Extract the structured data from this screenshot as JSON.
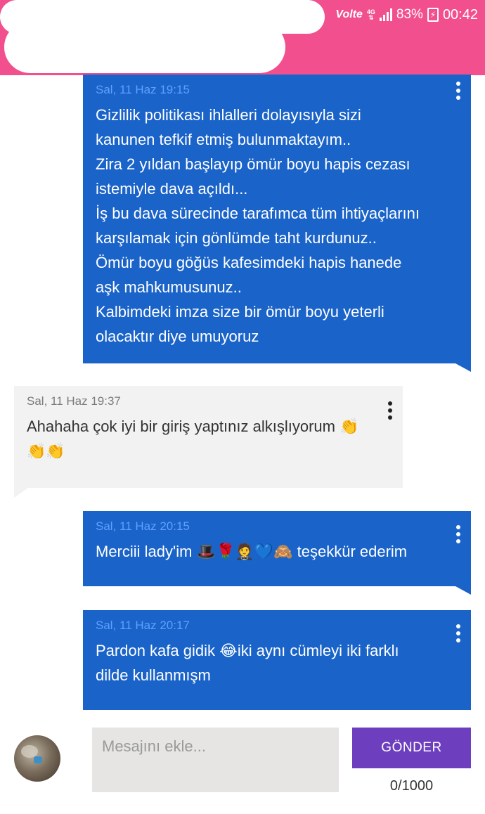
{
  "status_bar": {
    "volte": "Volte",
    "network": "4G",
    "battery_percent": "83%",
    "battery_glyph": "⚡",
    "time": "00:42"
  },
  "messages": [
    {
      "side": "right",
      "timestamp": "Sal, 11 Haz 19:15",
      "text": "Gizlilik politikası ihlalleri dolayısıyla sizi\nkanunen tefkif etmiş bulunmaktayım..\nZira 2 yıldan başlayıp ömür boyu hapis cezası\nistemiyle dava açıldı...\nİş bu dava sürecinde tarafımca tüm ihtiyaçlarını\nkarşılamak için gönlümde taht kurdunuz..\nÖmür boyu göğüs kafesimdeki hapis hanede\naşk mahkumusunuz..\nKalbimdeki imza size bir ömür boyu yeterli\nolacaktır diye umuyoruz"
    },
    {
      "side": "left",
      "timestamp": "Sal, 11 Haz 19:37",
      "text": "Ahahaha çok iyi bir giriş yaptınız alkışlıyorum 👏\n👏👏"
    },
    {
      "side": "right",
      "timestamp": "Sal, 11 Haz 20:15",
      "text": "Merciii lady'im 🎩🌹🤵💙🙈 teşekkür ederim"
    },
    {
      "side": "right",
      "timestamp": "Sal, 11 Haz 20:17",
      "text": "Pardon kafa gidik 😂iki aynı cümleyi iki farklı\ndilde kullanmışm"
    }
  ],
  "composer": {
    "placeholder": "Mesajını ekle...",
    "value": "",
    "send_label": "GÖNDER",
    "counter": "0/1000"
  },
  "colors": {
    "header": "#f24f8e",
    "sent_bubble": "#1a63c9",
    "received_bubble": "#f2f2f2",
    "send_button": "#6d3fbf"
  }
}
